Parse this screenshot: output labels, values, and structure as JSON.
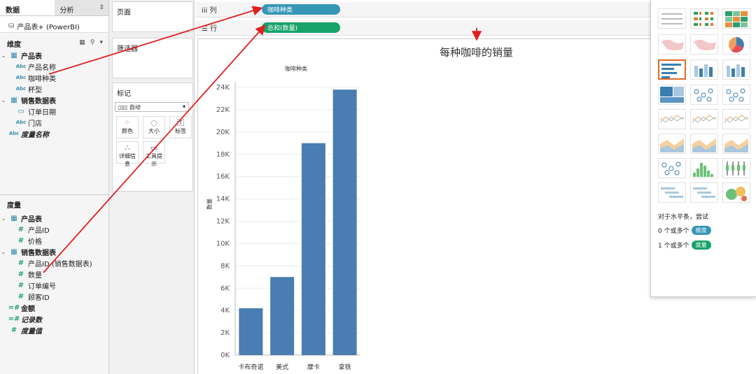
{
  "tabs": {
    "data": "数据",
    "analysis": "分析"
  },
  "datasource": "产品表+ (PowerBI)",
  "dimensions_header": "维度",
  "measures_header": "度量",
  "dimensions": [
    {
      "label": "产品表",
      "type": "table",
      "bold": true
    },
    {
      "label": "产品名称",
      "type": "abc"
    },
    {
      "label": "咖啡种类",
      "type": "abc"
    },
    {
      "label": "杯型",
      "type": "abc"
    },
    {
      "label": "销售数据表",
      "type": "table",
      "bold": true
    },
    {
      "label": "订单日期",
      "type": "date"
    },
    {
      "label": "门店",
      "type": "abc"
    },
    {
      "label": "度量名称",
      "type": "abc",
      "italic": true
    }
  ],
  "measures": [
    {
      "label": "产品表",
      "type": "table",
      "bold": true
    },
    {
      "label": "产品ID",
      "type": "num"
    },
    {
      "label": "价格",
      "type": "num"
    },
    {
      "label": "销售数据表",
      "type": "table",
      "bold": true
    },
    {
      "label": "产品ID (销售数据表)",
      "type": "num"
    },
    {
      "label": "数量",
      "type": "num"
    },
    {
      "label": "订单编号",
      "type": "num"
    },
    {
      "label": "顾客ID",
      "type": "num"
    },
    {
      "label": "金额",
      "type": "calc",
      "bold": true
    },
    {
      "label": "记录数",
      "type": "calc",
      "italic": true
    },
    {
      "label": "度量值",
      "type": "num",
      "italic": true
    }
  ],
  "cards": {
    "pages": "页面",
    "filters": "筛选器",
    "marks": "标记",
    "marks_type": "自动",
    "buttons": [
      "颜色",
      "大小",
      "标签",
      "详细信息",
      "工具提示"
    ]
  },
  "shelves": {
    "columns_label": "列",
    "rows_label": "行",
    "columns_pill": "咖啡种类",
    "rows_pill": "总和(数量)"
  },
  "chart_data": {
    "type": "bar",
    "title": "每种咖啡的销量",
    "xlabel": "咖啡种类",
    "ylabel": "数量",
    "categories": [
      "卡布奇诺",
      "美式",
      "摩卡",
      "拿铁"
    ],
    "values": [
      4200,
      7000,
      19000,
      23800
    ],
    "yticks": [
      "0K",
      "2K",
      "4K",
      "6K",
      "8K",
      "10K",
      "12K",
      "14K",
      "16K",
      "18K",
      "20K",
      "22K",
      "24K"
    ],
    "ylim": [
      0,
      24000
    ],
    "grid": true,
    "bar_color": "#4a7db1"
  },
  "showme": {
    "hint": "对于水平条，尝试",
    "req1_prefix": "0 个或多个",
    "req1_pill": "维度",
    "req2_prefix": "1 个或多个",
    "req2_pill": "度量"
  },
  "colors": {
    "dimension": "#3596b5",
    "measure": "#17a36a",
    "arrow": "#e02020",
    "selected": "#e06a2a"
  }
}
